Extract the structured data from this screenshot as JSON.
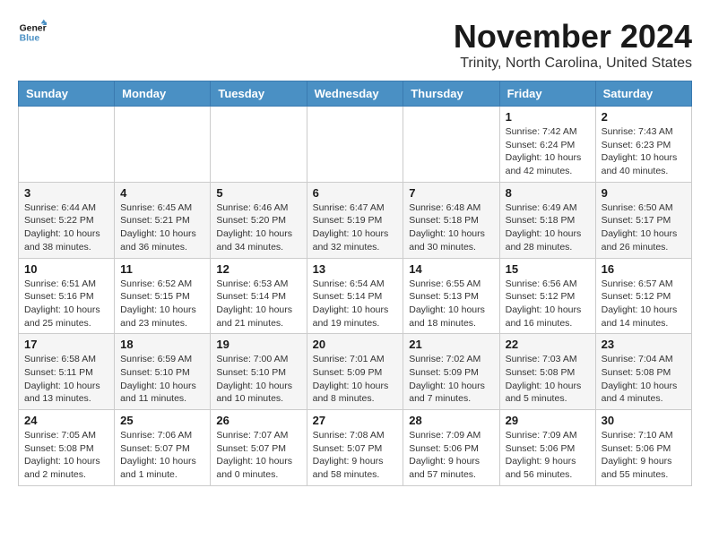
{
  "logo": {
    "line1": "General",
    "line2": "Blue"
  },
  "header": {
    "month": "November 2024",
    "location": "Trinity, North Carolina, United States"
  },
  "weekdays": [
    "Sunday",
    "Monday",
    "Tuesday",
    "Wednesday",
    "Thursday",
    "Friday",
    "Saturday"
  ],
  "weeks": [
    [
      {
        "day": "",
        "info": ""
      },
      {
        "day": "",
        "info": ""
      },
      {
        "day": "",
        "info": ""
      },
      {
        "day": "",
        "info": ""
      },
      {
        "day": "",
        "info": ""
      },
      {
        "day": "1",
        "info": "Sunrise: 7:42 AM\nSunset: 6:24 PM\nDaylight: 10 hours and 42 minutes."
      },
      {
        "day": "2",
        "info": "Sunrise: 7:43 AM\nSunset: 6:23 PM\nDaylight: 10 hours and 40 minutes."
      }
    ],
    [
      {
        "day": "3",
        "info": "Sunrise: 6:44 AM\nSunset: 5:22 PM\nDaylight: 10 hours and 38 minutes."
      },
      {
        "day": "4",
        "info": "Sunrise: 6:45 AM\nSunset: 5:21 PM\nDaylight: 10 hours and 36 minutes."
      },
      {
        "day": "5",
        "info": "Sunrise: 6:46 AM\nSunset: 5:20 PM\nDaylight: 10 hours and 34 minutes."
      },
      {
        "day": "6",
        "info": "Sunrise: 6:47 AM\nSunset: 5:19 PM\nDaylight: 10 hours and 32 minutes."
      },
      {
        "day": "7",
        "info": "Sunrise: 6:48 AM\nSunset: 5:18 PM\nDaylight: 10 hours and 30 minutes."
      },
      {
        "day": "8",
        "info": "Sunrise: 6:49 AM\nSunset: 5:18 PM\nDaylight: 10 hours and 28 minutes."
      },
      {
        "day": "9",
        "info": "Sunrise: 6:50 AM\nSunset: 5:17 PM\nDaylight: 10 hours and 26 minutes."
      }
    ],
    [
      {
        "day": "10",
        "info": "Sunrise: 6:51 AM\nSunset: 5:16 PM\nDaylight: 10 hours and 25 minutes."
      },
      {
        "day": "11",
        "info": "Sunrise: 6:52 AM\nSunset: 5:15 PM\nDaylight: 10 hours and 23 minutes."
      },
      {
        "day": "12",
        "info": "Sunrise: 6:53 AM\nSunset: 5:14 PM\nDaylight: 10 hours and 21 minutes."
      },
      {
        "day": "13",
        "info": "Sunrise: 6:54 AM\nSunset: 5:14 PM\nDaylight: 10 hours and 19 minutes."
      },
      {
        "day": "14",
        "info": "Sunrise: 6:55 AM\nSunset: 5:13 PM\nDaylight: 10 hours and 18 minutes."
      },
      {
        "day": "15",
        "info": "Sunrise: 6:56 AM\nSunset: 5:12 PM\nDaylight: 10 hours and 16 minutes."
      },
      {
        "day": "16",
        "info": "Sunrise: 6:57 AM\nSunset: 5:12 PM\nDaylight: 10 hours and 14 minutes."
      }
    ],
    [
      {
        "day": "17",
        "info": "Sunrise: 6:58 AM\nSunset: 5:11 PM\nDaylight: 10 hours and 13 minutes."
      },
      {
        "day": "18",
        "info": "Sunrise: 6:59 AM\nSunset: 5:10 PM\nDaylight: 10 hours and 11 minutes."
      },
      {
        "day": "19",
        "info": "Sunrise: 7:00 AM\nSunset: 5:10 PM\nDaylight: 10 hours and 10 minutes."
      },
      {
        "day": "20",
        "info": "Sunrise: 7:01 AM\nSunset: 5:09 PM\nDaylight: 10 hours and 8 minutes."
      },
      {
        "day": "21",
        "info": "Sunrise: 7:02 AM\nSunset: 5:09 PM\nDaylight: 10 hours and 7 minutes."
      },
      {
        "day": "22",
        "info": "Sunrise: 7:03 AM\nSunset: 5:08 PM\nDaylight: 10 hours and 5 minutes."
      },
      {
        "day": "23",
        "info": "Sunrise: 7:04 AM\nSunset: 5:08 PM\nDaylight: 10 hours and 4 minutes."
      }
    ],
    [
      {
        "day": "24",
        "info": "Sunrise: 7:05 AM\nSunset: 5:08 PM\nDaylight: 10 hours and 2 minutes."
      },
      {
        "day": "25",
        "info": "Sunrise: 7:06 AM\nSunset: 5:07 PM\nDaylight: 10 hours and 1 minute."
      },
      {
        "day": "26",
        "info": "Sunrise: 7:07 AM\nSunset: 5:07 PM\nDaylight: 10 hours and 0 minutes."
      },
      {
        "day": "27",
        "info": "Sunrise: 7:08 AM\nSunset: 5:07 PM\nDaylight: 9 hours and 58 minutes."
      },
      {
        "day": "28",
        "info": "Sunrise: 7:09 AM\nSunset: 5:06 PM\nDaylight: 9 hours and 57 minutes."
      },
      {
        "day": "29",
        "info": "Sunrise: 7:09 AM\nSunset: 5:06 PM\nDaylight: 9 hours and 56 minutes."
      },
      {
        "day": "30",
        "info": "Sunrise: 7:10 AM\nSunset: 5:06 PM\nDaylight: 9 hours and 55 minutes."
      }
    ]
  ]
}
